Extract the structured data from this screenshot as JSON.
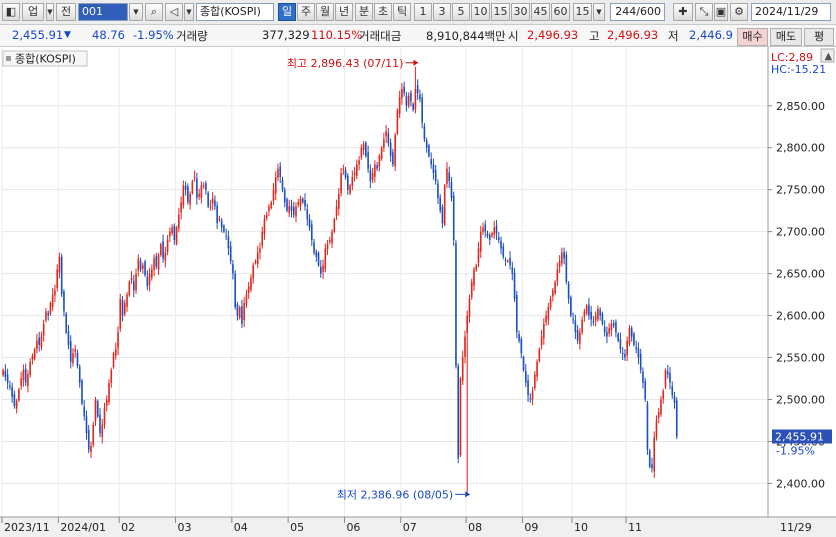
{
  "toolbar": {
    "market": "업",
    "scope": "전",
    "code": "001",
    "name": "종합(KOSPI)",
    "periods": [
      "일",
      "주",
      "월",
      "년",
      "분",
      "초",
      "틱"
    ],
    "active_period": "일",
    "intervals": [
      "1",
      "3",
      "5",
      "10",
      "15",
      "30",
      "45",
      "60",
      "15"
    ],
    "count": "244/600",
    "date": "2024/11/29"
  },
  "info": {
    "price": "2,455.91",
    "change": "48.76",
    "change_pct": "-1.95%",
    "volume_label": "거래량",
    "volume": "377,329",
    "volume_pct": "110.15%",
    "amount_label": "거래대금",
    "amount": "8,910,844백만",
    "open_label": "시",
    "open": "2,496.93",
    "high_label": "고",
    "high": "2,496.93",
    "low_label": "저",
    "low": "2,446.9",
    "buy_label": "매수",
    "sell_label": "매도",
    "eval_label": "평"
  },
  "chart_data": {
    "type": "candlestick",
    "title": "종합(KOSPI)",
    "corner_lc": "LC:2,89",
    "corner_hc": "HC:-15.21",
    "ylim": [
      2360,
      2920
    ],
    "yticks": [
      2400,
      2450,
      2500,
      2550,
      2600,
      2650,
      2700,
      2750,
      2800,
      2850
    ],
    "ytick_labels": [
      "2,400.00",
      "2,450.00",
      "2,500.00",
      "2,550.00",
      "2,600.00",
      "2,650.00",
      "2,700.00",
      "2,750.00",
      "2,800.00",
      "2,850.00"
    ],
    "xlabels": [
      {
        "label": "2023/11",
        "i": 0
      },
      {
        "label": "2024/01",
        "i": 25
      },
      {
        "label": "02",
        "i": 52
      },
      {
        "label": "03",
        "i": 77
      },
      {
        "label": "04",
        "i": 102
      },
      {
        "label": "05",
        "i": 127
      },
      {
        "label": "06",
        "i": 152
      },
      {
        "label": "07",
        "i": 177
      },
      {
        "label": "08",
        "i": 206
      },
      {
        "label": "09",
        "i": 231
      },
      {
        "label": "10",
        "i": 253
      },
      {
        "label": "11",
        "i": 277
      },
      {
        "label": "11/29",
        "i": 312
      }
    ],
    "n_slots": 340,
    "max_annotation": "최고 2,896.43 (07/11)",
    "max_index": 183,
    "max_value": 2896.43,
    "min_annotation": "최저 2,386.96 (08/05)",
    "min_index": 206,
    "min_value": 2386.96,
    "last_price": "2,455.91",
    "last_change": "-1.95%",
    "last_value": 2455.91,
    "closes": [
      2535,
      2527,
      2520,
      2515,
      2503,
      2492,
      2498,
      2512,
      2525,
      2535,
      2520,
      2530,
      2545,
      2552,
      2560,
      2570,
      2565,
      2575,
      2590,
      2605,
      2600,
      2615,
      2625,
      2630,
      2655,
      2670,
      2625,
      2605,
      2580,
      2565,
      2545,
      2555,
      2560,
      2540,
      2520,
      2495,
      2480,
      2460,
      2440,
      2445,
      2470,
      2500,
      2480,
      2460,
      2470,
      2490,
      2500,
      2520,
      2535,
      2555,
      2560,
      2580,
      2620,
      2600,
      2615,
      2625,
      2640,
      2645,
      2630,
      2650,
      2668,
      2655,
      2660,
      2648,
      2635,
      2650,
      2655,
      2668,
      2658,
      2672,
      2685,
      2668,
      2675,
      2690,
      2700,
      2705,
      2690,
      2705,
      2720,
      2735,
      2755,
      2750,
      2735,
      2745,
      2760,
      2765,
      2740,
      2745,
      2755,
      2755,
      2750,
      2730,
      2730,
      2740,
      2730,
      2710,
      2715,
      2705,
      2700,
      2695,
      2680,
      2665,
      2650,
      2610,
      2600,
      2610,
      2590,
      2615,
      2625,
      2635,
      2645,
      2660,
      2665,
      2675,
      2680,
      2700,
      2715,
      2720,
      2730,
      2735,
      2750,
      2765,
      2775,
      2765,
      2750,
      2735,
      2725,
      2730,
      2725,
      2720,
      2730,
      2735,
      2740,
      2735,
      2730,
      2715,
      2705,
      2690,
      2675,
      2670,
      2660,
      2650,
      2660,
      2680,
      2685,
      2690,
      2700,
      2715,
      2730,
      2745,
      2770,
      2775,
      2765,
      2750,
      2755,
      2765,
      2770,
      2780,
      2785,
      2800,
      2805,
      2790,
      2775,
      2760,
      2770,
      2780,
      2775,
      2790,
      2800,
      2810,
      2820,
      2805,
      2790,
      2780,
      2815,
      2845,
      2860,
      2870,
      2865,
      2850,
      2862,
      2855,
      2845,
      2870,
      2865,
      2858,
      2830,
      2810,
      2800,
      2790,
      2780,
      2770,
      2760,
      2740,
      2725,
      2710,
      2755,
      2775,
      2760,
      2740,
      2690,
      2540,
      2430,
      2525,
      2550,
      2575,
      2600,
      2620,
      2640,
      2655,
      2660,
      2680,
      2700,
      2705,
      2700,
      2695,
      2690,
      2698,
      2705,
      2698,
      2690,
      2680,
      2670,
      2665,
      2665,
      2660,
      2650,
      2620,
      2580,
      2570,
      2555,
      2535,
      2520,
      2505,
      2500,
      2510,
      2530,
      2545,
      2560,
      2575,
      2590,
      2600,
      2610,
      2620,
      2630,
      2640,
      2655,
      2665,
      2675,
      2668,
      2640,
      2620,
      2600,
      2595,
      2580,
      2570,
      2580,
      2595,
      2605,
      2612,
      2600,
      2595,
      2592,
      2600,
      2608,
      2600,
      2590,
      2580,
      2575,
      2585,
      2590,
      2588,
      2580,
      2570,
      2560,
      2555,
      2550,
      2570,
      2585,
      2575,
      2565,
      2560,
      2550,
      2535,
      2520,
      2500,
      2440,
      2420,
      2418,
      2455,
      2475,
      2485,
      2500,
      2510,
      2535,
      2530,
      2520,
      2505,
      2496,
      2455.91
    ]
  }
}
